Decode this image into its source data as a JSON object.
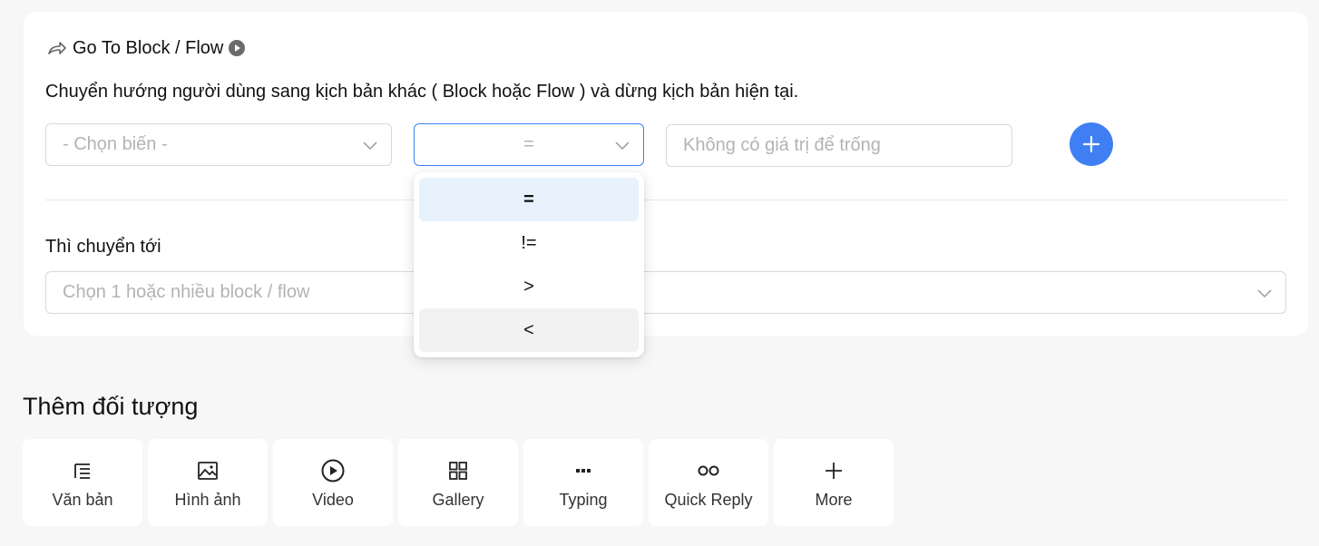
{
  "block": {
    "title": "Go To Block / Flow",
    "description": "Chuyển hướng người dùng sang kịch bản khác ( Block hoặc Flow ) và dừng kịch bản hiện tại.",
    "variable_placeholder": "- Chọn biến -",
    "operator_value": "=",
    "value_placeholder": "Không có giá trị để trống",
    "then_label": "Thì chuyển tới",
    "target_placeholder": "Chọn 1 hoặc nhiều block / flow"
  },
  "operator_options": [
    "=",
    "!=",
    ">",
    "<"
  ],
  "add_objects": {
    "title": "Thêm đối tượng",
    "items": [
      {
        "label": "Văn bản",
        "icon": "text-list-icon"
      },
      {
        "label": "Hình ảnh",
        "icon": "image-icon"
      },
      {
        "label": "Video",
        "icon": "play-circle-icon"
      },
      {
        "label": "Gallery",
        "icon": "grid-icon"
      },
      {
        "label": "Typing",
        "icon": "dots-icon"
      },
      {
        "label": "Quick Reply",
        "icon": "quick-reply-icon"
      },
      {
        "label": "More",
        "icon": "plus-icon"
      }
    ]
  },
  "colors": {
    "accent": "#3f7ff3",
    "selected_option_bg": "#e7f2fd",
    "focus_border": "#3b82f6"
  }
}
